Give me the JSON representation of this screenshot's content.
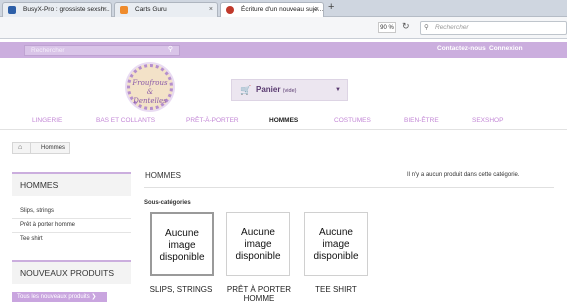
{
  "browser": {
    "tabs": [
      {
        "title": "BusyX-Pro : grossiste sexsh...",
        "color": "#2d5fa8"
      },
      {
        "title": "Carts Guru",
        "color": "#ef8b2c"
      },
      {
        "title": "Écriture d'un nouveau suje...",
        "color": "#c0392b"
      }
    ],
    "new_tab": "+",
    "zoom": "90 %",
    "search_placeholder": "Rechercher"
  },
  "site": {
    "search_placeholder": "Rechercher",
    "top_links": [
      "Contactez-nous",
      "Connexion"
    ],
    "logo_text": [
      "Froufrous",
      "&",
      "Dentelles"
    ],
    "cart_label": "Panier",
    "cart_status": "(vide)",
    "menu": [
      "LINGERIE",
      "BAS ET COLLANTS",
      "PRÊT-À-PORTER",
      "HOMMES",
      "COSTUMES",
      "BIEN-ÊTRE",
      "SEXSHOP"
    ],
    "active_menu": "HOMMES",
    "accent": "#cbaede"
  },
  "breadcrumb": {
    "label": "Hommes"
  },
  "sidebar": {
    "title": "HOMMES",
    "items": [
      "Slips, strings",
      "Prêt à porter homme",
      "Tee shirt"
    ],
    "new_products_title": "NOUVEAUX PRODUITS",
    "new_products_button": "Tous les nouveaux produits ❯"
  },
  "main": {
    "title": "HOMMES",
    "empty_message": "Il n'y a aucun produit dans cette catégorie.",
    "subcategories_label": "Sous-catégories",
    "no_image_text": "Aucune image disponible",
    "subcategories": [
      "SLIPS, STRINGS",
      "PRÊT À PORTER HOMME",
      "TEE SHIRT"
    ]
  }
}
